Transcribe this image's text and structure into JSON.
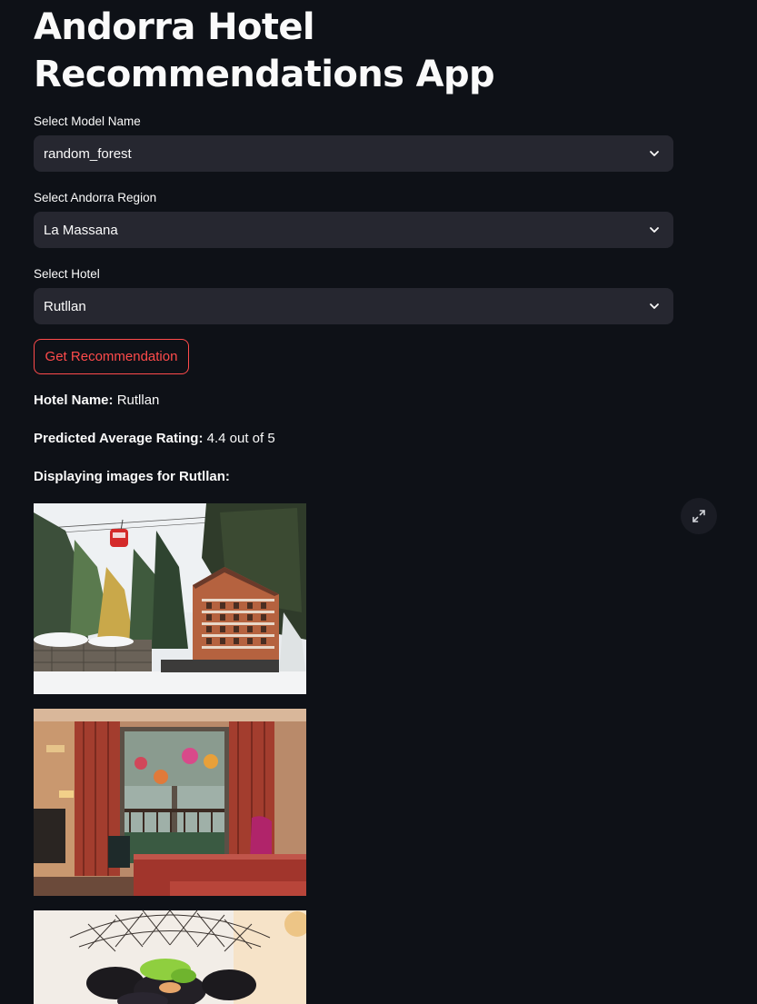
{
  "app": {
    "title": "Andorra Hotel Recommendations App"
  },
  "selects": {
    "model": {
      "label": "Select Model Name",
      "value": "random_forest"
    },
    "region": {
      "label": "Select Andorra Region",
      "value": "La Massana"
    },
    "hotel": {
      "label": "Select Hotel",
      "value": "Rutllan"
    }
  },
  "actions": {
    "get_recommendation_label": "Get Recommendation"
  },
  "results": {
    "hotel_name_label": "Hotel Name",
    "hotel_name_value": "Rutllan",
    "rating_label": "Predicted Average Rating",
    "rating_value": "4.4 out of 5",
    "images_heading": "Displaying images for Rutllan:"
  },
  "images": [
    {
      "name": "hotel-exterior-image",
      "subject": "hotel exterior with snow, pine trees and cable car"
    },
    {
      "name": "hotel-room-image",
      "subject": "hotel room with beds, balcony door and flowers"
    },
    {
      "name": "food-image",
      "subject": "mussels dish"
    }
  ],
  "icons": {
    "chevron": "chevron-down-icon",
    "expand": "fullscreen-icon"
  },
  "colors": {
    "background": "#0e1117",
    "select_background": "#262730",
    "accent": "#ff4b4b",
    "text": "#fafafa"
  }
}
